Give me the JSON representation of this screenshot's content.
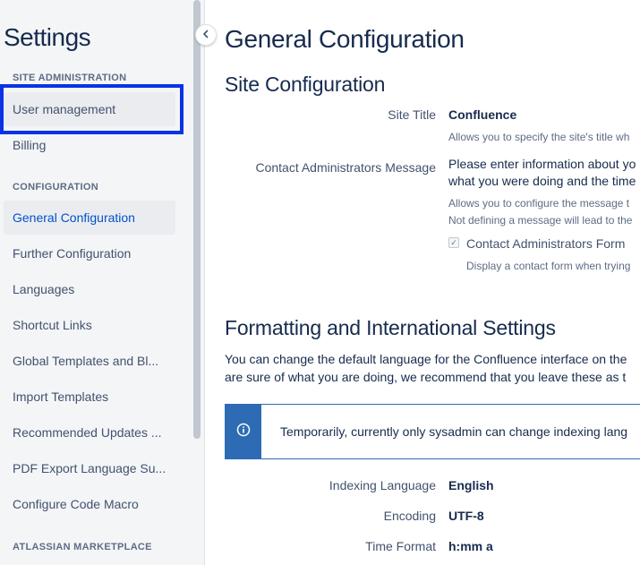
{
  "sidebar": {
    "title": "Settings",
    "sections": {
      "site_admin": "SITE ADMINISTRATION",
      "configuration": "CONFIGURATION",
      "marketplace": "ATLASSIAN MARKETPLACE"
    },
    "items": {
      "user_management": "User management",
      "billing": "Billing",
      "general_configuration": "General Configuration",
      "further_configuration": "Further Configuration",
      "languages": "Languages",
      "shortcut_links": "Shortcut Links",
      "global_templates": "Global Templates and Bl...",
      "import_templates": "Import Templates",
      "recommended_updates": "Recommended Updates ...",
      "pdf_export": "PDF Export Language Su...",
      "code_macro": "Configure Code Macro"
    },
    "highlight_color": "#0a32e6",
    "scroll_position": 0
  },
  "main": {
    "page_title": "General Configuration",
    "site_config": {
      "heading": "Site Configuration",
      "site_title_label": "Site Title",
      "site_title_value": "Confluence",
      "site_title_desc": "Allows you to specify the site's title wh",
      "contact_label": "Contact Administrators Message",
      "contact_value_line1": "Please enter information about yo",
      "contact_value_line2": "what you were doing and the time",
      "contact_desc_line1": "Allows you to configure the message t",
      "contact_desc_line2": "Not defining a message will lead to the",
      "contact_form_label": "Contact Administrators Form",
      "contact_form_checked": true,
      "contact_form_desc": "Display a contact form when trying"
    },
    "formatting": {
      "heading": "Formatting and International Settings",
      "para_line1": "You can change the default language for the Confluence interface on the",
      "para_line2": "are sure of what you are doing, we recommend that you leave these as t",
      "info_text": "Temporarily, currently only sysadmin can change indexing lang",
      "indexing_label": "Indexing Language",
      "indexing_value": "English",
      "encoding_label": "Encoding",
      "encoding_value": "UTF-8",
      "time_format_label": "Time Format",
      "time_format_value": "h:mm a"
    },
    "info_color": "#2d6cb4"
  }
}
